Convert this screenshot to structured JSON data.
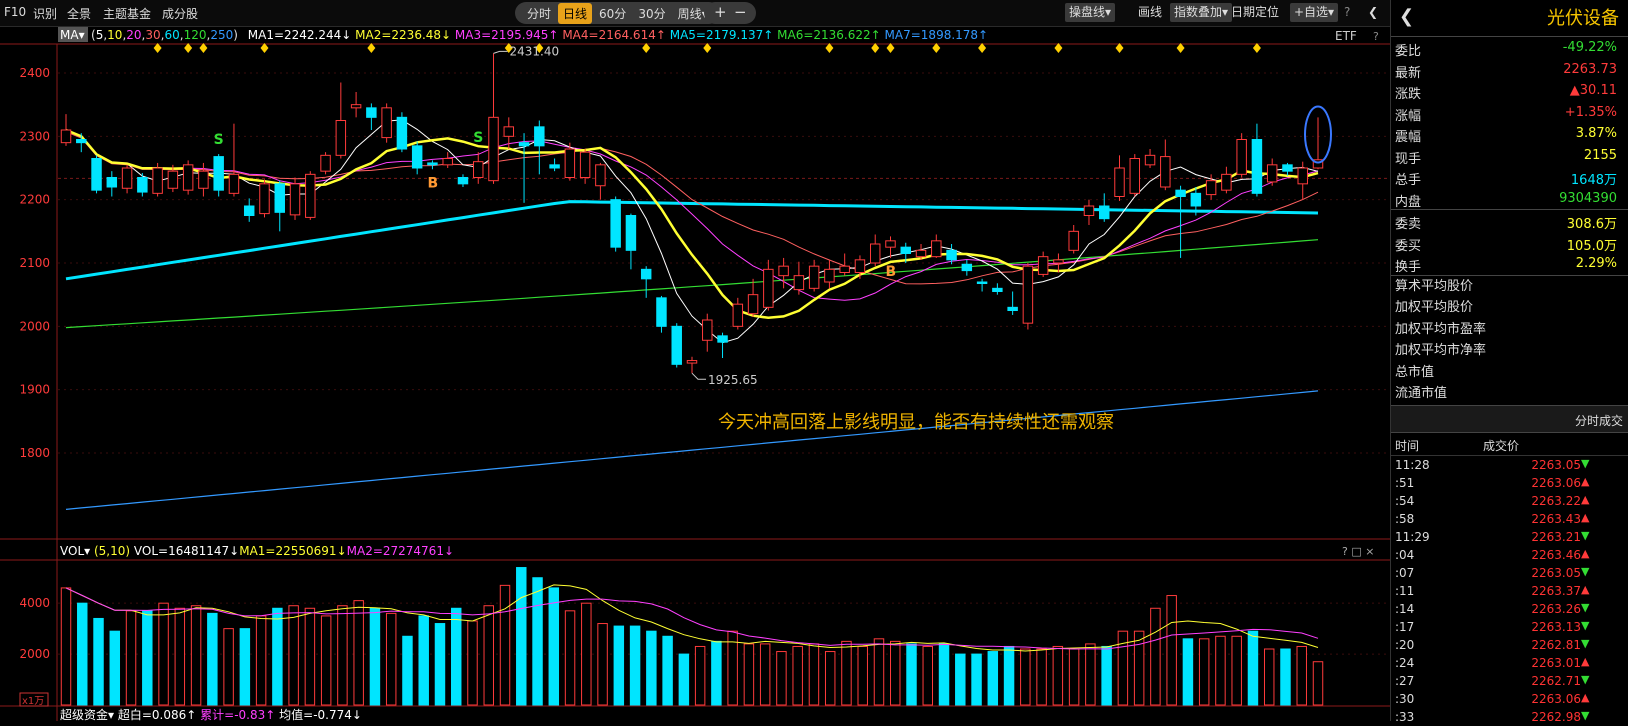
{
  "toolbar": {
    "left": [
      "F10",
      "识别",
      "全景",
      "主题基金",
      "成分股"
    ],
    "periods": [
      "分时",
      "日线",
      "60分",
      "30分",
      "周线▾"
    ],
    "active_period": "日线",
    "zoom_in": "+",
    "zoom_out": "−",
    "right": [
      "操盘线▾",
      "画线",
      "指数叠加▾",
      "日期定位",
      "+自选▾"
    ],
    "help": "?",
    "collapse": "❮"
  },
  "ma_legend": {
    "selector": "MA▾",
    "periods_prefix": "(",
    "p1": "5",
    "p2": "10",
    "p3": "20",
    "p4": "30",
    "p5": "60",
    "p6": "120",
    "p7": "250",
    "periods_suffix": ")",
    "ma1": "MA1=2242.244↓",
    "ma2": "MA2=2236.48↓",
    "ma3": "MA3=2195.945↑",
    "ma4": "MA4=2164.614↑",
    "ma5": "MA5=2179.137↑",
    "ma6": "MA6=2136.622↑",
    "ma7": "MA7=1898.178↑",
    "etf": "ETF",
    "help": "?"
  },
  "vol_legend": {
    "selector": "VOL▾",
    "periods": "(5,10)",
    "vol": "VOL=16481147↓",
    "ma1": "MA1=22550691↓",
    "ma2": "MA2=27274761↓",
    "controls": "? □ ×"
  },
  "bottom_legend": {
    "name": "超级资金▾",
    "a": "超白=0.086↑",
    "b": "累计=-0.83↑",
    "c": "均值=-0.774↓"
  },
  "annotation": "今天冲高回落上影线明显，能否有持续性还需观察",
  "price_axis_ticks": [
    "2400",
    "2300",
    "2200",
    "2100",
    "2000",
    "1900",
    "1800"
  ],
  "vol_axis_ticks": [
    "4000",
    "2000"
  ],
  "zoom_badge": "x1万",
  "colors": {
    "up": "#ff3b3b",
    "down": "#00e5ff",
    "ma1": "#ffffff",
    "ma2": "#ffff33",
    "ma3": "#ff40ff",
    "ma4": "#ff6060",
    "ma5": "#00e5ff",
    "ma6": "#33dd33",
    "ma7": "#3399ff"
  },
  "chart_data": {
    "type": "candlestick",
    "title": "光伏设备",
    "ylim": [
      1700,
      2440
    ],
    "high_label": "2431.40",
    "low_label": "1925.65",
    "candles": [
      {
        "o": 2290,
        "c": 2310,
        "h": 2335,
        "l": 2285
      },
      {
        "o": 2295,
        "c": 2290,
        "h": 2305,
        "l": 2275
      },
      {
        "o": 2265,
        "c": 2215,
        "h": 2270,
        "l": 2210
      },
      {
        "o": 2235,
        "c": 2220,
        "h": 2245,
        "l": 2205
      },
      {
        "o": 2218,
        "c": 2250,
        "h": 2255,
        "l": 2210
      },
      {
        "o": 2235,
        "c": 2212,
        "h": 2242,
        "l": 2205
      },
      {
        "o": 2210,
        "c": 2250,
        "h": 2258,
        "l": 2205
      },
      {
        "o": 2218,
        "c": 2245,
        "h": 2255,
        "l": 2212
      },
      {
        "o": 2215,
        "c": 2255,
        "h": 2262,
        "l": 2208
      },
      {
        "o": 2218,
        "c": 2245,
        "h": 2258,
        "l": 2205
      },
      {
        "o": 2268,
        "c": 2215,
        "h": 2272,
        "l": 2205
      },
      {
        "o": 2210,
        "c": 2240,
        "h": 2320,
        "l": 2205
      },
      {
        "o": 2190,
        "c": 2175,
        "h": 2202,
        "l": 2165
      },
      {
        "o": 2178,
        "c": 2225,
        "h": 2232,
        "l": 2172
      },
      {
        "o": 2225,
        "c": 2180,
        "h": 2230,
        "l": 2150
      },
      {
        "o": 2176,
        "c": 2225,
        "h": 2235,
        "l": 2168
      },
      {
        "o": 2172,
        "c": 2240,
        "h": 2245,
        "l": 2168
      },
      {
        "o": 2245,
        "c": 2270,
        "h": 2275,
        "l": 2240
      },
      {
        "o": 2270,
        "c": 2325,
        "h": 2385,
        "l": 2265
      },
      {
        "o": 2345,
        "c": 2350,
        "h": 2370,
        "l": 2330
      },
      {
        "o": 2345,
        "c": 2330,
        "h": 2352,
        "l": 2310
      },
      {
        "o": 2298,
        "c": 2345,
        "h": 2352,
        "l": 2290
      },
      {
        "o": 2330,
        "c": 2280,
        "h": 2338,
        "l": 2275
      },
      {
        "o": 2285,
        "c": 2250,
        "h": 2292,
        "l": 2240
      },
      {
        "o": 2258,
        "c": 2255,
        "h": 2262,
        "l": 2248
      },
      {
        "o": 2255,
        "c": 2265,
        "h": 2275,
        "l": 2250
      },
      {
        "o": 2235,
        "c": 2225,
        "h": 2240,
        "l": 2220
      },
      {
        "o": 2235,
        "c": 2260,
        "h": 2275,
        "l": 2225
      },
      {
        "o": 2230,
        "c": 2330,
        "h": 2431,
        "l": 2225
      },
      {
        "o": 2300,
        "c": 2315,
        "h": 2330,
        "l": 2280
      },
      {
        "o": 2290,
        "c": 2285,
        "h": 2305,
        "l": 2195
      },
      {
        "o": 2315,
        "c": 2285,
        "h": 2325,
        "l": 2240
      },
      {
        "o": 2255,
        "c": 2250,
        "h": 2265,
        "l": 2245
      },
      {
        "o": 2235,
        "c": 2280,
        "h": 2290,
        "l": 2230
      },
      {
        "o": 2235,
        "c": 2275,
        "h": 2280,
        "l": 2225
      },
      {
        "o": 2222,
        "c": 2255,
        "h": 2258,
        "l": 2200
      },
      {
        "o": 2200,
        "c": 2125,
        "h": 2205,
        "l": 2118
      },
      {
        "o": 2175,
        "c": 2120,
        "h": 2178,
        "l": 2090
      },
      {
        "o": 2090,
        "c": 2075,
        "h": 2095,
        "l": 2045
      },
      {
        "o": 2045,
        "c": 2000,
        "h": 2048,
        "l": 1990
      },
      {
        "o": 2000,
        "c": 1940,
        "h": 2005,
        "l": 1935
      },
      {
        "o": 1942,
        "c": 1946,
        "h": 1952,
        "l": 1926
      },
      {
        "o": 1978,
        "c": 2010,
        "h": 2020,
        "l": 1960
      },
      {
        "o": 1985,
        "c": 1975,
        "h": 1990,
        "l": 1950
      },
      {
        "o": 2000,
        "c": 2035,
        "h": 2045,
        "l": 1995
      },
      {
        "o": 2020,
        "c": 2050,
        "h": 2075,
        "l": 2015
      },
      {
        "o": 2030,
        "c": 2090,
        "h": 2105,
        "l": 2025
      },
      {
        "o": 2080,
        "c": 2095,
        "h": 2108,
        "l": 2060
      },
      {
        "o": 2058,
        "c": 2080,
        "h": 2102,
        "l": 2050
      },
      {
        "o": 2060,
        "c": 2095,
        "h": 2105,
        "l": 2055
      },
      {
        "o": 2070,
        "c": 2090,
        "h": 2105,
        "l": 2060
      },
      {
        "o": 2085,
        "c": 2095,
        "h": 2115,
        "l": 2080
      },
      {
        "o": 2085,
        "c": 2105,
        "h": 2112,
        "l": 2075
      },
      {
        "o": 2100,
        "c": 2130,
        "h": 2145,
        "l": 2095
      },
      {
        "o": 2125,
        "c": 2135,
        "h": 2142,
        "l": 2108
      },
      {
        "o": 2125,
        "c": 2115,
        "h": 2132,
        "l": 2100
      },
      {
        "o": 2110,
        "c": 2120,
        "h": 2130,
        "l": 2105
      },
      {
        "o": 2110,
        "c": 2135,
        "h": 2145,
        "l": 2108
      },
      {
        "o": 2120,
        "c": 2105,
        "h": 2130,
        "l": 2098
      },
      {
        "o": 2098,
        "c": 2088,
        "h": 2105,
        "l": 2080
      },
      {
        "o": 2070,
        "c": 2068,
        "h": 2075,
        "l": 2055
      },
      {
        "o": 2060,
        "c": 2055,
        "h": 2068,
        "l": 2050
      },
      {
        "o": 2030,
        "c": 2025,
        "h": 2055,
        "l": 2018
      },
      {
        "o": 2005,
        "c": 2095,
        "h": 2100,
        "l": 1995
      },
      {
        "o": 2082,
        "c": 2110,
        "h": 2118,
        "l": 2078
      },
      {
        "o": 2100,
        "c": 2105,
        "h": 2115,
        "l": 2085
      },
      {
        "o": 2120,
        "c": 2150,
        "h": 2160,
        "l": 2115
      },
      {
        "o": 2175,
        "c": 2190,
        "h": 2200,
        "l": 2160
      },
      {
        "o": 2190,
        "c": 2170,
        "h": 2210,
        "l": 2165
      },
      {
        "o": 2205,
        "c": 2250,
        "h": 2270,
        "l": 2198
      },
      {
        "o": 2210,
        "c": 2265,
        "h": 2272,
        "l": 2205
      },
      {
        "o": 2255,
        "c": 2270,
        "h": 2280,
        "l": 2250
      },
      {
        "o": 2220,
        "c": 2268,
        "h": 2295,
        "l": 2215
      },
      {
        "o": 2215,
        "c": 2205,
        "h": 2222,
        "l": 2108
      },
      {
        "o": 2210,
        "c": 2190,
        "h": 2220,
        "l": 2175
      },
      {
        "o": 2208,
        "c": 2230,
        "h": 2240,
        "l": 2200
      },
      {
        "o": 2215,
        "c": 2240,
        "h": 2252,
        "l": 2210
      },
      {
        "o": 2240,
        "c": 2295,
        "h": 2305,
        "l": 2235
      },
      {
        "o": 2295,
        "c": 2210,
        "h": 2320,
        "l": 2205
      },
      {
        "o": 2228,
        "c": 2255,
        "h": 2265,
        "l": 2222
      },
      {
        "o": 2255,
        "c": 2245,
        "h": 2258,
        "l": 2238
      },
      {
        "o": 2225,
        "c": 2250,
        "h": 2260,
        "l": 2200
      },
      {
        "o": 2250,
        "c": 2263,
        "h": 2330,
        "l": 2248
      }
    ],
    "volume": [
      4600,
      4000,
      3400,
      2900,
      3700,
      3700,
      4000,
      3800,
      3900,
      3600,
      3000,
      3000,
      3500,
      3800,
      3900,
      3800,
      3500,
      3900,
      4100,
      3800,
      3600,
      2700,
      3500,
      3200,
      3800,
      3300,
      3900,
      4700,
      5400,
      5000,
      4600,
      3700,
      4000,
      3200,
      3100,
      3100,
      2900,
      2700,
      2000,
      2300,
      2500,
      2900,
      2400,
      2400,
      2100,
      2300,
      2400,
      2100,
      2500,
      2300,
      2600,
      2500,
      2400,
      2300,
      2400,
      2000,
      2000,
      2100,
      2300,
      2200,
      2200,
      2300,
      2200,
      2400,
      2300,
      2900,
      2900,
      3800,
      4300,
      2600,
      2600,
      2700,
      2700,
      2900,
      2200,
      2200,
      2300,
      1700
    ],
    "markers": [
      {
        "i": 10,
        "label": "S",
        "color": "#33dd33"
      },
      {
        "i": 24,
        "label": "B",
        "color": "#ff9933"
      },
      {
        "i": 27,
        "label": "S",
        "color": "#33dd33"
      },
      {
        "i": 54,
        "label": "B",
        "color": "#ff9933"
      }
    ]
  },
  "quote": {
    "back": "❮",
    "name": "光伏设备",
    "rows1": [
      {
        "label": "委比",
        "value": "-49.22%",
        "color": "#33dd33"
      },
      {
        "label": "最新",
        "value": "2263.73",
        "color": "#ff3b3b"
      },
      {
        "label": "涨跌",
        "value": "▲30.11",
        "color": "#ff3b3b"
      },
      {
        "label": "涨幅",
        "value": "+1.35%",
        "color": "#ff3b3b"
      },
      {
        "label": "震幅",
        "value": "3.87%",
        "color": "#ffff33"
      },
      {
        "label": "现手",
        "value": "2155",
        "color": "#ffff33"
      },
      {
        "label": "总手",
        "value": "1648万",
        "color": "#00e5ff"
      },
      {
        "label": "内盘",
        "value": "9304390",
        "color": "#33dd33"
      }
    ],
    "rows2": [
      {
        "label": "委卖",
        "value": "308.6万",
        "color": "#ffff33"
      },
      {
        "label": "委买",
        "value": "105.0万",
        "color": "#ffff33"
      },
      {
        "label": "换手",
        "value": "2.29%",
        "color": "#ffff33"
      }
    ],
    "links": [
      "算术平均股价",
      "加权平均股价",
      "加权平均市盈率",
      "加权平均市净率",
      "总市值",
      "流通市值"
    ],
    "ticks_header": "分时成交",
    "col_time": "时间",
    "col_price": "成交价",
    "ticks": [
      {
        "t": "11:28",
        "p": "2263.05",
        "d": "▼"
      },
      {
        "t": ":51",
        "p": "2263.06",
        "d": "▲"
      },
      {
        "t": ":54",
        "p": "2263.22",
        "d": "▲"
      },
      {
        "t": ":58",
        "p": "2263.43",
        "d": "▲"
      },
      {
        "t": "11:29",
        "p": "2263.21",
        "d": "▼"
      },
      {
        "t": ":04",
        "p": "2263.46",
        "d": "▲"
      },
      {
        "t": ":07",
        "p": "2263.05",
        "d": "▼"
      },
      {
        "t": ":11",
        "p": "2263.37",
        "d": "▲"
      },
      {
        "t": ":14",
        "p": "2263.26",
        "d": "▼"
      },
      {
        "t": ":17",
        "p": "2263.13",
        "d": "▼"
      },
      {
        "t": ":20",
        "p": "2262.81",
        "d": "▼"
      },
      {
        "t": ":24",
        "p": "2263.01",
        "d": "▲"
      },
      {
        "t": ":27",
        "p": "2262.71",
        "d": "▼"
      },
      {
        "t": ":30",
        "p": "2263.06",
        "d": "▲"
      },
      {
        "t": ":33",
        "p": "2262.98",
        "d": "▼"
      }
    ]
  }
}
